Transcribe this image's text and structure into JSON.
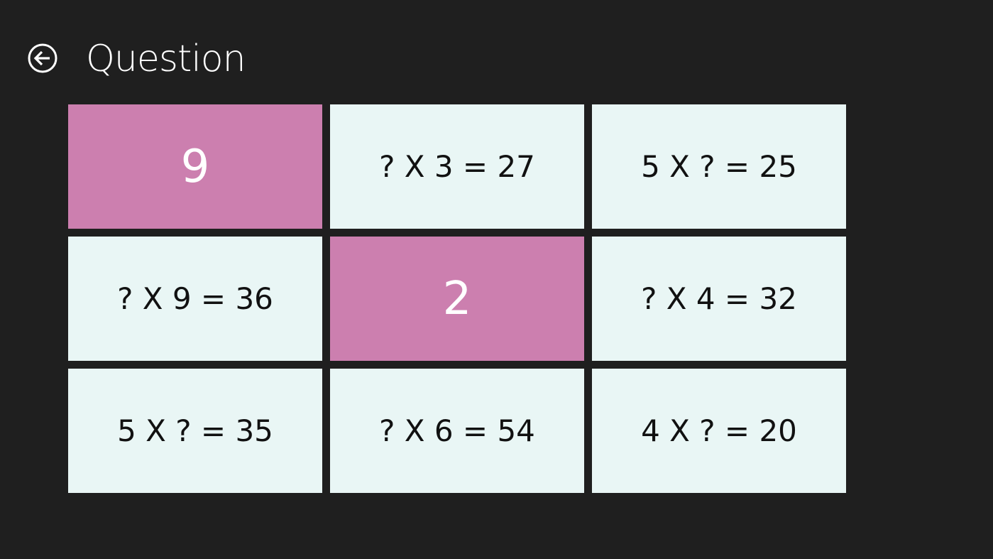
{
  "header": {
    "title": "Question",
    "back_icon": "back-arrow-circle-icon"
  },
  "colors": {
    "background": "#1f1f1f",
    "tile_default": "#e9f6f5",
    "tile_selected": "#cc7faf",
    "tile_text": "#111111",
    "selected_text": "#ffffff"
  },
  "tiles": [
    {
      "text": "9",
      "selected": true
    },
    {
      "text": "? X 3 = 27",
      "selected": false
    },
    {
      "text": "5 X ? = 25",
      "selected": false
    },
    {
      "text": "? X 9 = 36",
      "selected": false
    },
    {
      "text": "2",
      "selected": true
    },
    {
      "text": "? X 4 = 32",
      "selected": false
    },
    {
      "text": "5 X ? = 35",
      "selected": false
    },
    {
      "text": "? X 6 = 54",
      "selected": false
    },
    {
      "text": "4 X ? = 20",
      "selected": false
    }
  ]
}
